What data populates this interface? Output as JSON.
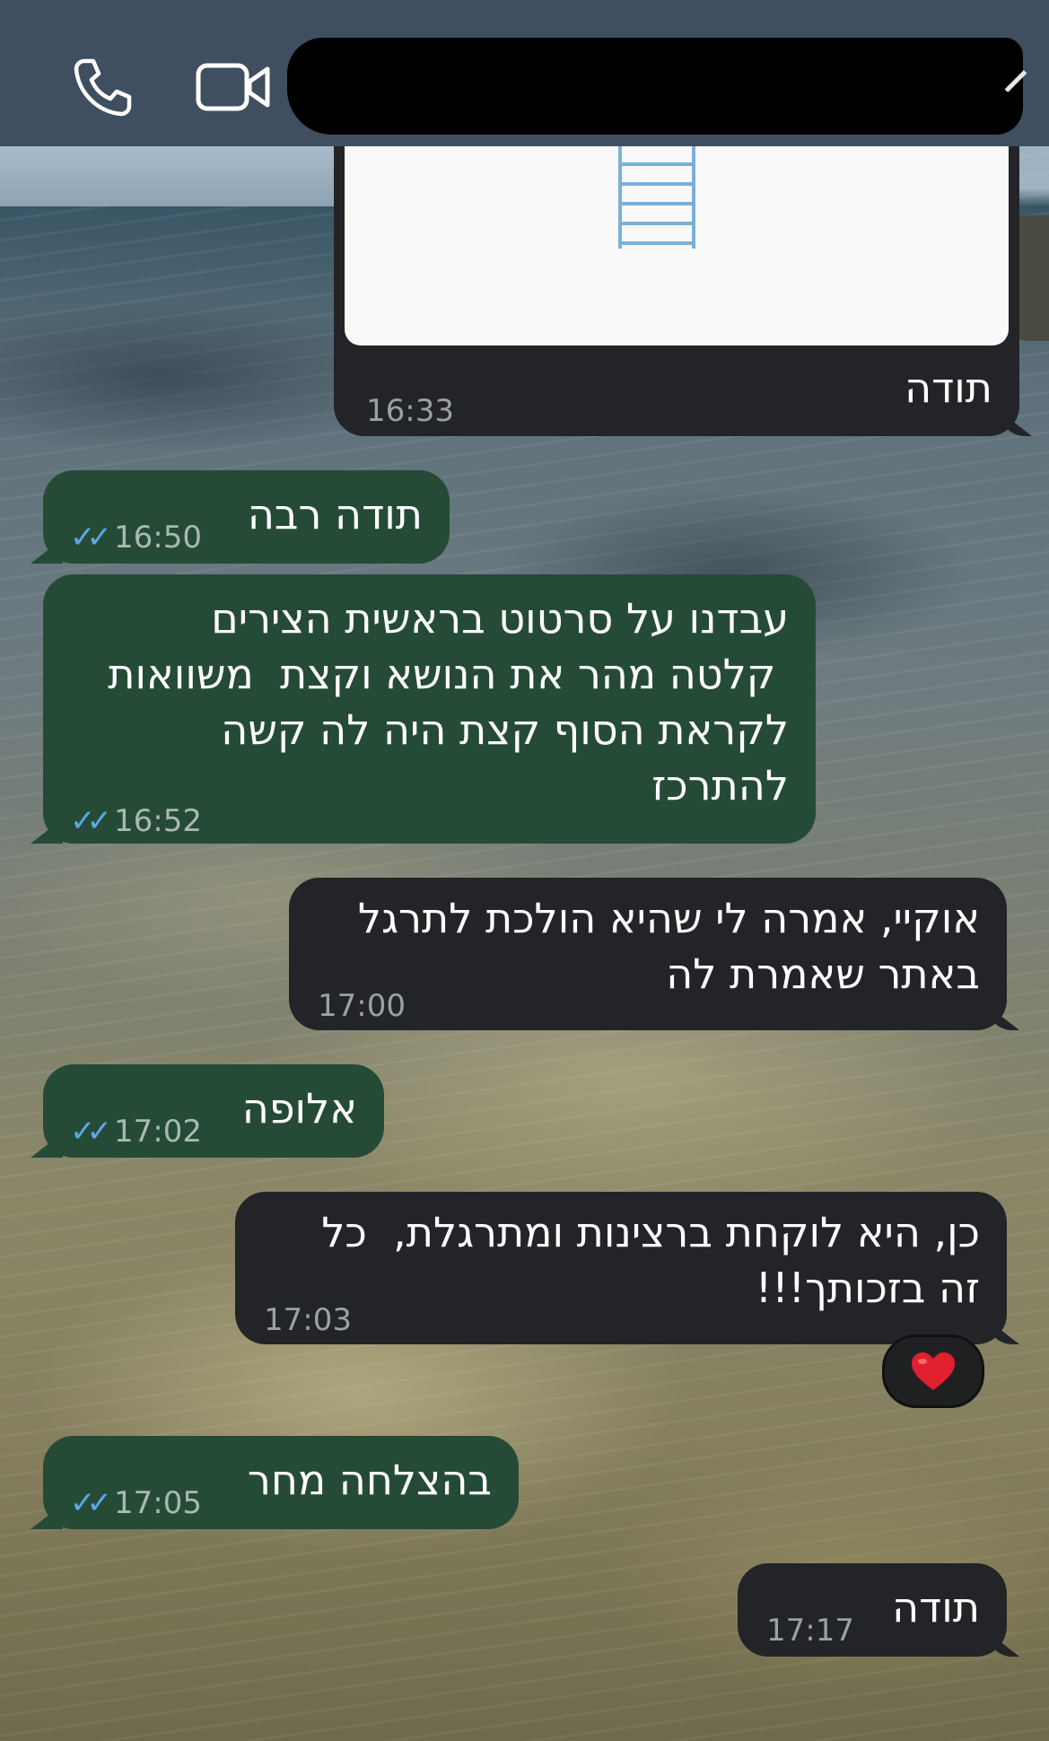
{
  "header": {
    "call_icon": "phone-icon",
    "video_icon": "video-camera-icon",
    "contact_name_redacted": true
  },
  "messages": [
    {
      "text": "תודה",
      "time": "16:33",
      "side": "incoming",
      "has_image": true
    },
    {
      "text": "תודה רבה",
      "time": "16:50",
      "side": "outgoing",
      "read": true
    },
    {
      "text": "עבדנו על סרטוט בראשית הצירים\n קלטה מהר את הנושא וקצת  משוואות\nלקראת הסוף קצת היה לה קשה\nלהתרכז",
      "time": "16:52",
      "side": "outgoing",
      "read": true
    },
    {
      "text": "אוקיי, אמרה לי שהיא הולכת לתרגל\nבאתר שאמרת לה",
      "time": "17:00",
      "side": "incoming"
    },
    {
      "text": "אלופה",
      "time": "17:02",
      "side": "outgoing",
      "read": true
    },
    {
      "text": "כן, היא לוקחת ברצינות ומתרגלת,  כל\nזה בזכותך!!!",
      "time": "17:03",
      "side": "incoming",
      "reaction": "❤️"
    },
    {
      "text": "בהצלחה מחר",
      "time": "17:05",
      "side": "outgoing",
      "read": true
    },
    {
      "text": "תודה",
      "time": "17:17",
      "side": "incoming"
    }
  ],
  "colors": {
    "header_bg": "#3f4f5f",
    "incoming_bubble": "#232427",
    "outgoing_bubble": "#254b36",
    "read_ticks": "#5ba7e6",
    "reaction_heart": "#e0202f"
  }
}
